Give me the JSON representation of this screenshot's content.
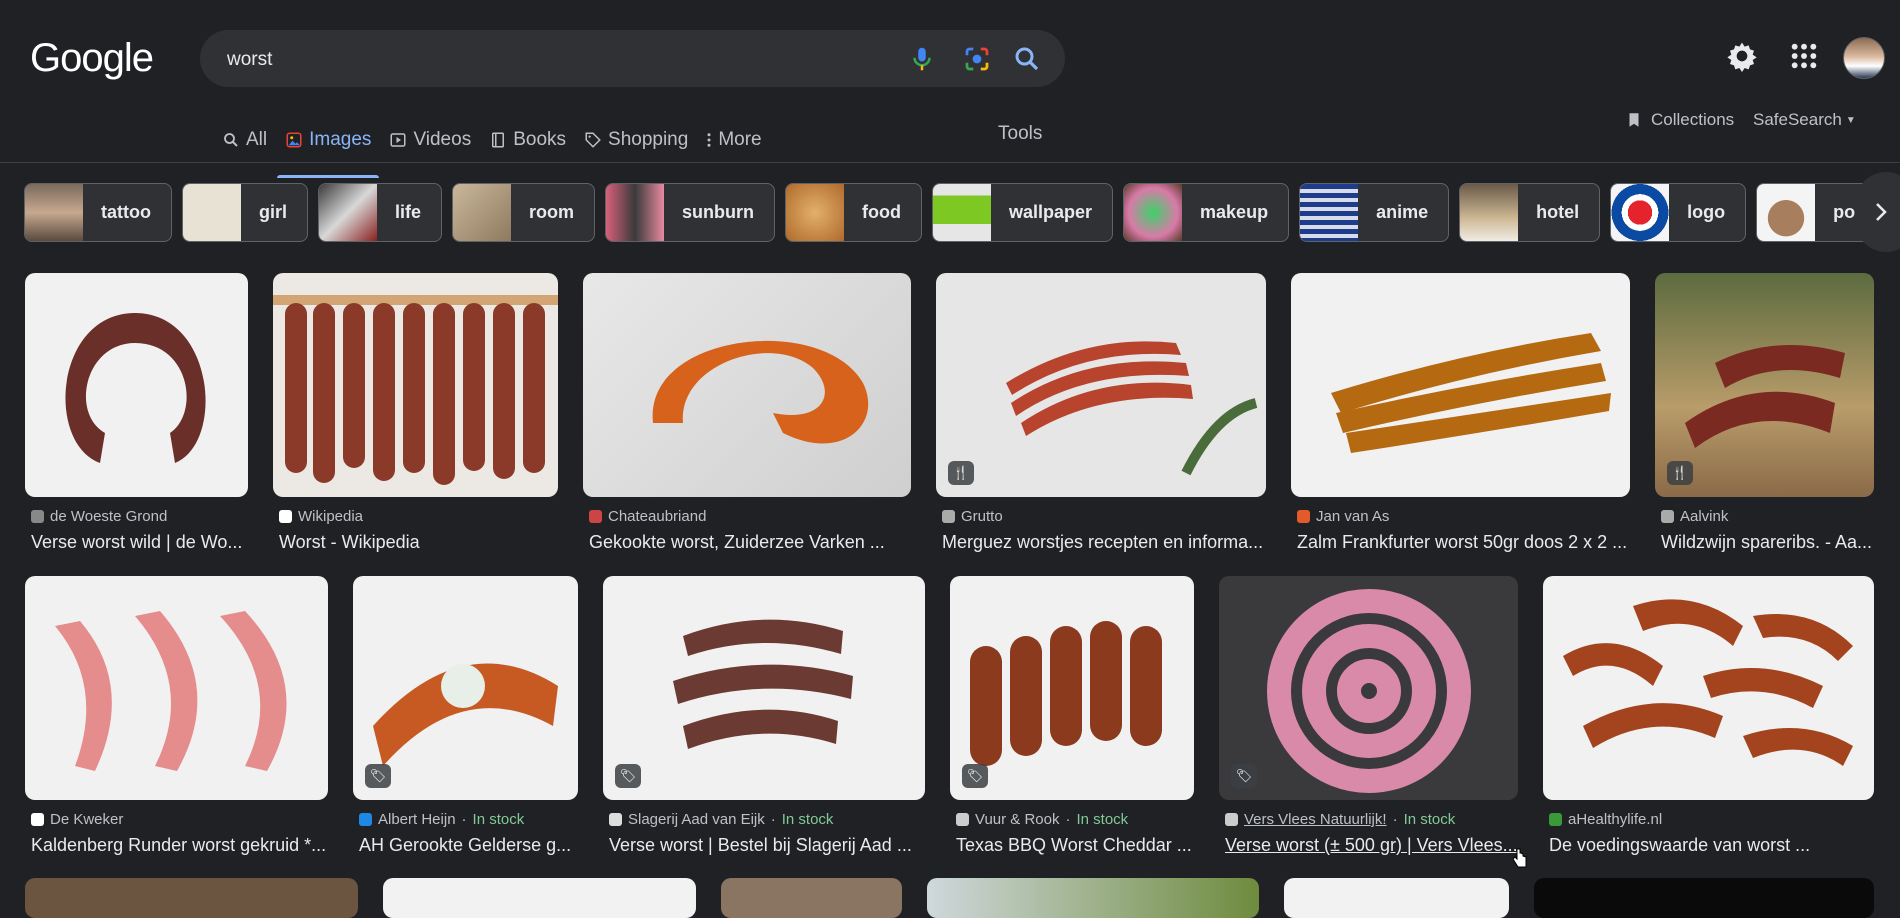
{
  "logo": "Google",
  "search": {
    "query": "worst"
  },
  "tabs": [
    {
      "label": "All",
      "icon": "search-icon"
    },
    {
      "label": "Images",
      "icon": "image-icon",
      "active": true
    },
    {
      "label": "Videos",
      "icon": "play-icon"
    },
    {
      "label": "Books",
      "icon": "book-icon"
    },
    {
      "label": "Shopping",
      "icon": "tag-icon"
    },
    {
      "label": "More",
      "icon": "more-vert-icon"
    }
  ],
  "tools": "Tools",
  "collections": "Collections",
  "safesearch": "SafeSearch",
  "chips": [
    "tattoo",
    "girl",
    "life",
    "room",
    "sunburn",
    "food",
    "wallpaper",
    "makeup",
    "anime",
    "hotel",
    "logo",
    "pokemon"
  ],
  "row1": [
    {
      "source": "de Woeste Grond",
      "title": "Verse worst wild | de Wo..."
    },
    {
      "source": "Wikipedia",
      "title": "Worst - Wikipedia"
    },
    {
      "source": "Chateaubriand",
      "title": "Gekookte worst, Zuiderzee Varken ..."
    },
    {
      "source": "Grutto",
      "title": "Merguez worstjes recepten en informa..."
    },
    {
      "source": "Jan van As",
      "title": "Zalm Frankfurter worst 50gr doos 2 x 2 ..."
    },
    {
      "source": "Aalvink",
      "title": "Wildzwijn spareribs. - Aa..."
    }
  ],
  "row2": [
    {
      "source": "De Kweker",
      "stock": "",
      "title": "Kaldenberg Runder worst gekruid *..."
    },
    {
      "source": "Albert Heijn",
      "stock": "In stock",
      "title": "AH Gerookte Gelderse g..."
    },
    {
      "source": "Slagerij Aad van Eijk",
      "stock": "In stock",
      "title": "Verse worst | Bestel bij Slagerij Aad ..."
    },
    {
      "source": "Vuur & Rook",
      "stock": "In stock",
      "title": "Texas BBQ Worst Cheddar ..."
    },
    {
      "source": "Vers Vlees Natuurlijk!",
      "stock": "In stock",
      "title": "Verse worst (± 500 gr) | Vers Vlees..."
    },
    {
      "source": "aHealthylife.nl",
      "stock": "",
      "title": "De voedingswaarde van worst ..."
    }
  ],
  "separator": " · ",
  "colors": {
    "background": "#202124",
    "accent": "#8ab4f8",
    "in_stock": "#81c995"
  }
}
